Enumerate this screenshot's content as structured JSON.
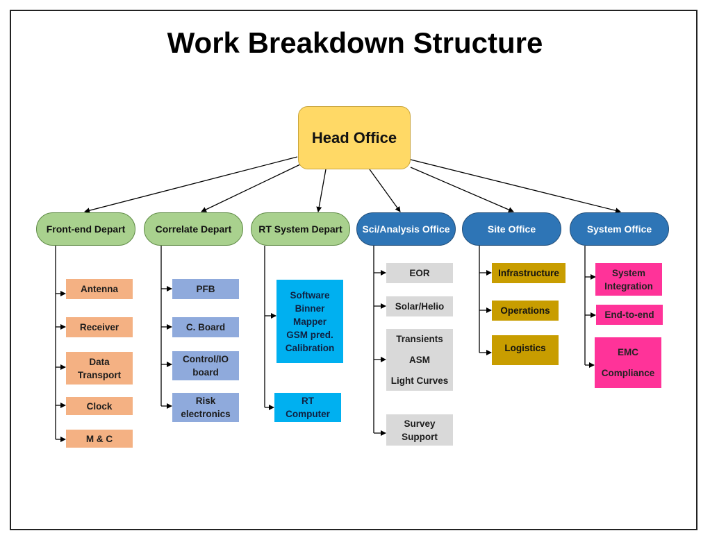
{
  "title": "Work Breakdown Structure",
  "root": {
    "label": "Head Office",
    "color": "#ffd966"
  },
  "departments": [
    {
      "label": "Front-end Depart",
      "color": "#a9d18e",
      "children": [
        "Antenna",
        "Receiver",
        "Data Transport",
        "Clock",
        "M & C"
      ]
    },
    {
      "label": "Correlate Depart",
      "color": "#a9d18e",
      "children": [
        "PFB",
        "C. Board",
        "Control/IO board",
        "Risk electronics"
      ]
    },
    {
      "label": "RT System Depart",
      "color": "#a9d18e",
      "children": [
        {
          "lines": [
            "Software",
            "Binner",
            "Mapper",
            "GSM pred.",
            "Calibration"
          ]
        },
        {
          "lines": [
            "RT",
            "Computer"
          ]
        }
      ]
    },
    {
      "label": "Sci/Analysis Office",
      "color": "#2e75b6",
      "children": [
        {
          "lines": [
            "EOR"
          ]
        },
        {
          "lines": [
            "Solar/Helio"
          ]
        },
        {
          "lines": [
            "Transients",
            "ASM",
            "Light Curves"
          ]
        },
        {
          "lines": [
            "Survey",
            "Support"
          ]
        }
      ]
    },
    {
      "label": "Site Office",
      "color": "#2e75b6",
      "children": [
        "Infrastructure",
        "Operations",
        "Logistics"
      ]
    },
    {
      "label": "System Office",
      "color": "#2e75b6",
      "children": [
        {
          "lines": [
            "System",
            "Integration"
          ]
        },
        {
          "lines": [
            "End-to-end"
          ]
        },
        {
          "lines": [
            "EMC",
            "Compliance"
          ]
        }
      ]
    }
  ],
  "leaf_colors": {
    "front_end": "#f4b183",
    "correlate": "#8faadc",
    "rt_system": "#00b0f0",
    "sci_analysis": "#d9d9d9",
    "site": "#c89d00",
    "system": "#ff3399"
  }
}
